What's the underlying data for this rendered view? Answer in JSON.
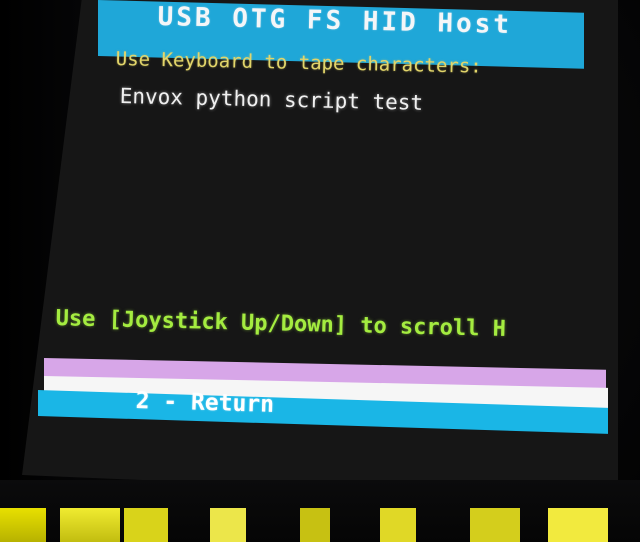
{
  "screen": {
    "title": "USB OTG FS HID Host",
    "prompt": "Use Keyboard to tape characters:",
    "typed_text": "Envox python script test",
    "hint": "Use [Joystick Up/Down] to scroll H",
    "footer_label": "2 - Return"
  },
  "colors": {
    "header_bar": "#1fa7d8",
    "prompt_text": "#e2d56a",
    "typed_text": "#f0f0f0",
    "hint_text": "#a4ec40",
    "footer_pink": "#d7a6e8",
    "footer_white": "#f6f6f6",
    "footer_blue": "#1ab6e6",
    "screen_background": "#161616"
  }
}
